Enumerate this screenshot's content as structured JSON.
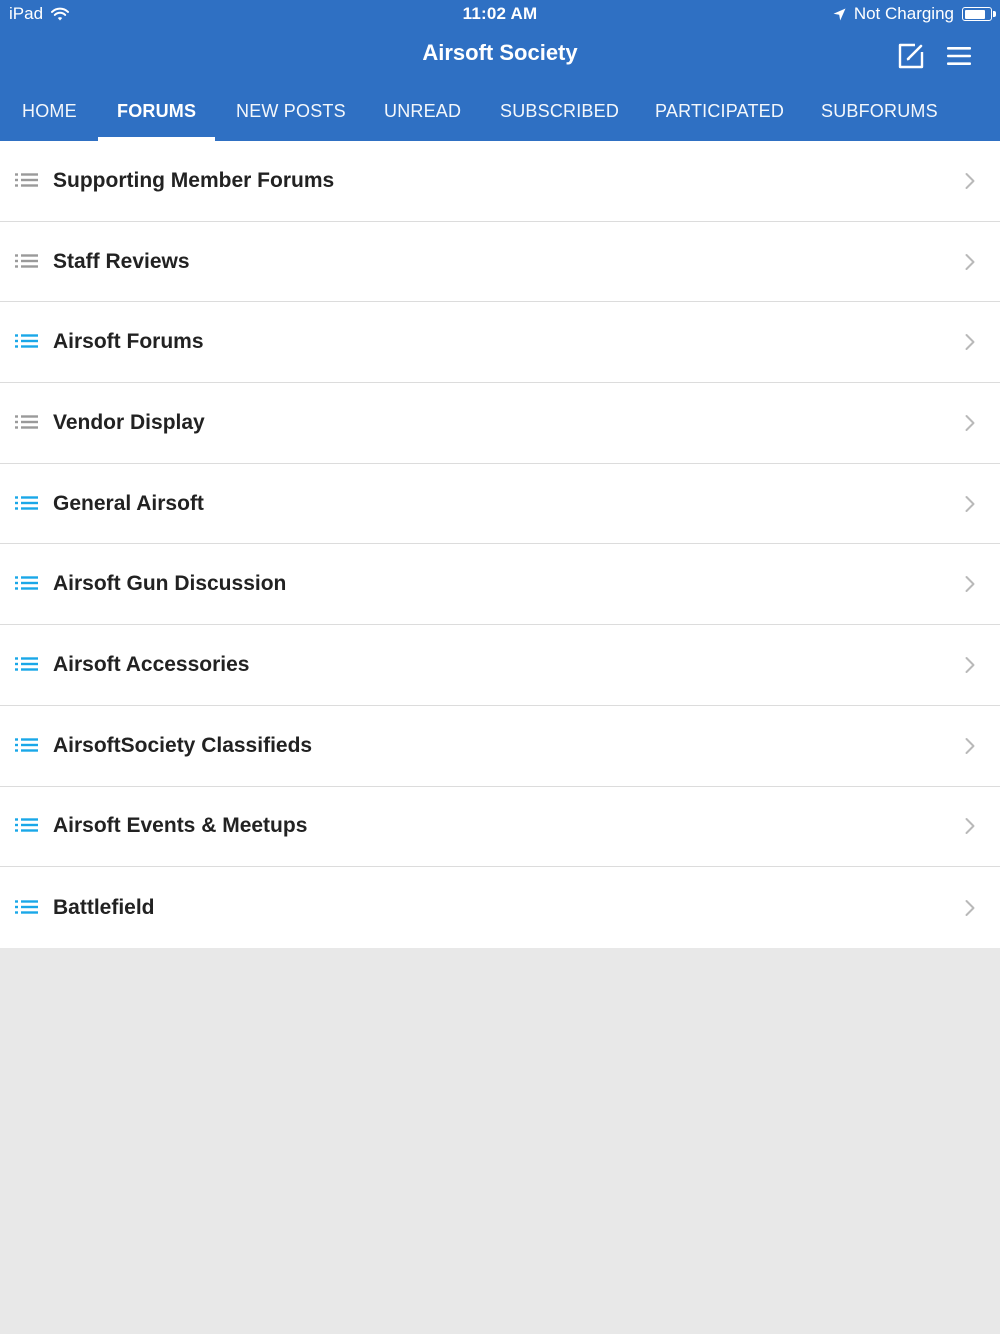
{
  "status_bar": {
    "device": "iPad",
    "time": "11:02 AM",
    "battery_text": "Not Charging",
    "battery_level": 0.8
  },
  "header": {
    "title": "Airsoft Society"
  },
  "tabs": [
    {
      "label": "HOME",
      "active": false
    },
    {
      "label": "FORUMS",
      "active": true
    },
    {
      "label": "NEW POSTS",
      "active": false
    },
    {
      "label": "UNREAD",
      "active": false
    },
    {
      "label": "SUBSCRIBED",
      "active": false
    },
    {
      "label": "PARTICIPATED",
      "active": false
    },
    {
      "label": "SUBFORUMS",
      "active": false
    }
  ],
  "forums": [
    {
      "label": "Supporting Member Forums",
      "icon": "list-icon",
      "unread": false
    },
    {
      "label": "Staff Reviews",
      "icon": "list-icon",
      "unread": false
    },
    {
      "label": "Airsoft Forums",
      "icon": "list-icon",
      "unread": true
    },
    {
      "label": "Vendor Display",
      "icon": "list-icon",
      "unread": false
    },
    {
      "label": "General Airsoft",
      "icon": "list-icon",
      "unread": true
    },
    {
      "label": "Airsoft Gun Discussion",
      "icon": "list-icon",
      "unread": true
    },
    {
      "label": "Airsoft Accessories",
      "icon": "list-icon",
      "unread": true
    },
    {
      "label": "AirsoftSociety Classifieds",
      "icon": "list-icon",
      "unread": true
    },
    {
      "label": "Airsoft Events & Meetups",
      "icon": "list-icon",
      "unread": true
    },
    {
      "label": "Battlefield",
      "icon": "list-icon",
      "unread": true
    }
  ],
  "colors": {
    "header_bg": "#2f70c3",
    "unread_icon": "#1aa7e8",
    "read_icon": "#9a9a9a",
    "chevron": "#b9b9b9",
    "background": "#e8e8e8"
  }
}
